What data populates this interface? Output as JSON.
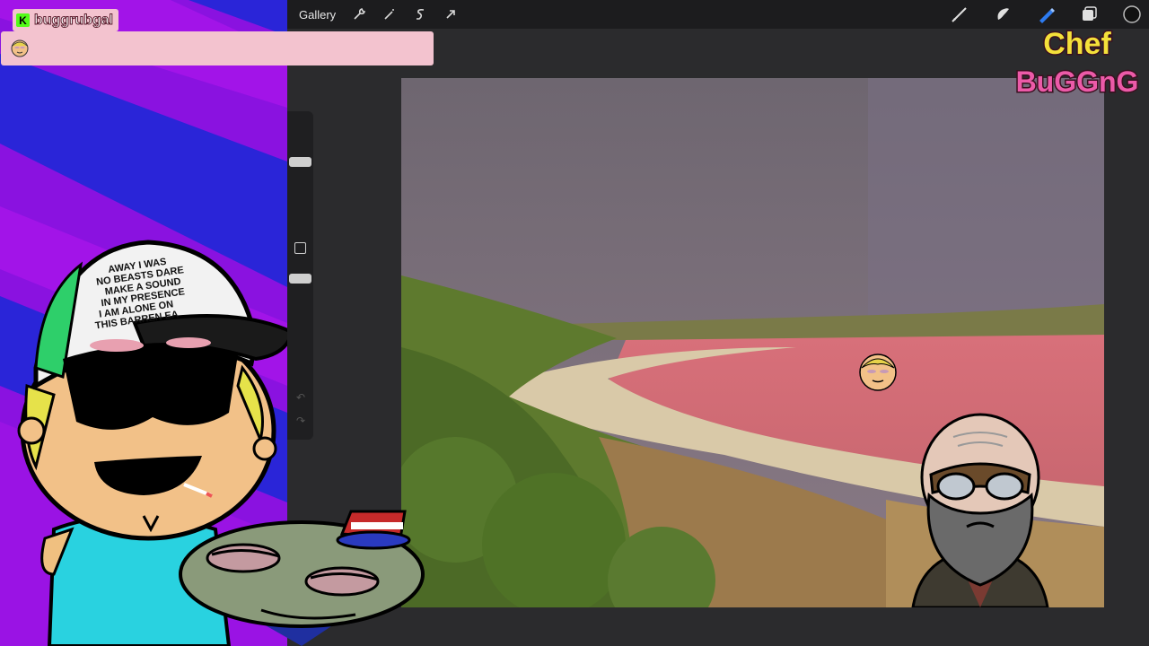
{
  "toolbar": {
    "gallery_label": "Gallery",
    "left_icons": [
      "wrench-icon",
      "magic-wand-icon",
      "selection-s-icon",
      "transform-arrow-icon"
    ],
    "right_icons": [
      "brush-icon",
      "smudge-icon",
      "eraser-icon",
      "layers-icon",
      "color-circle-icon"
    ]
  },
  "chat": {
    "platform_badge": "K",
    "username": "buggrubgal"
  },
  "logo": {
    "line1": "Chef",
    "line2": "BuGGnG"
  },
  "overlay_cap_text": "AWAY I WAS\nNO BEASTS DARE\nMAKE A SOUND\nIN MY PRESENCE\nI AM ALONE ON\nTHIS BARREN EA",
  "colors": {
    "overlay_purple": "#8a12e0",
    "overlay_blue": "#2a25d8",
    "chat_pink": "#f3c3cf",
    "lake_pink": "#d86a74",
    "toolbar_bg": "#1c1c1e",
    "eraser_blue": "#2d7bf0"
  }
}
